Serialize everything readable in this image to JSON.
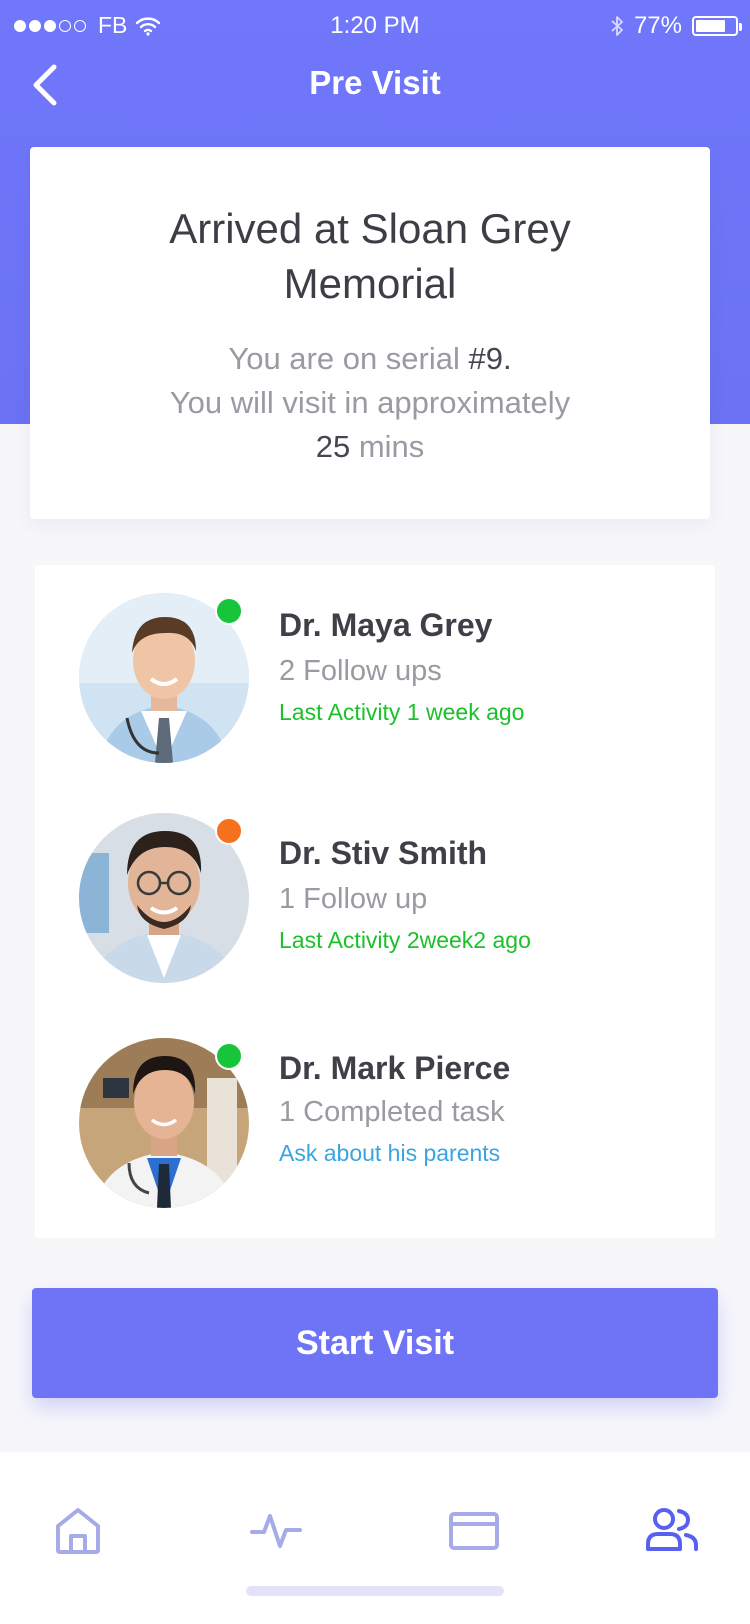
{
  "status_bar": {
    "carrier": "FB",
    "time": "1:20 PM",
    "battery": "77%",
    "battery_level": 0.77
  },
  "nav": {
    "title": "Pre Visit",
    "back_icon": "chevron-left-icon"
  },
  "arrival": {
    "title": "Arrived at Sloan Grey Memorial",
    "serial_prefix": "You are on serial ",
    "serial": "#9.",
    "visit_line": "You will visit in approximately",
    "wait_value": "25",
    "wait_unit": " mins"
  },
  "doctors": [
    {
      "name": "Dr. Maya Grey",
      "subtitle": "2 Follow ups",
      "note": "Last Activity 1 week ago",
      "note_color": "#1bc12a",
      "status_color": "#16c53a"
    },
    {
      "name": "Dr. Stiv Smith",
      "subtitle": "1 Follow up",
      "note": "Last Activity 2week2 ago",
      "note_color": "#1bc12a",
      "status_color": "#f7701e"
    },
    {
      "name": "Dr. Mark Pierce",
      "subtitle": "1 Completed task",
      "note": "Ask about his parents",
      "note_color": "#3aa4e0",
      "status_color": "#16c53a"
    }
  ],
  "primary_action": {
    "label": "Start Visit"
  },
  "tab_bar": {
    "tabs": [
      {
        "icon": "home-icon",
        "active": false
      },
      {
        "icon": "activity-icon",
        "active": false
      },
      {
        "icon": "card-icon",
        "active": false
      },
      {
        "icon": "users-icon",
        "active": true
      }
    ],
    "active_color": "#5960ef",
    "inactive_color": "#a6abe8"
  }
}
